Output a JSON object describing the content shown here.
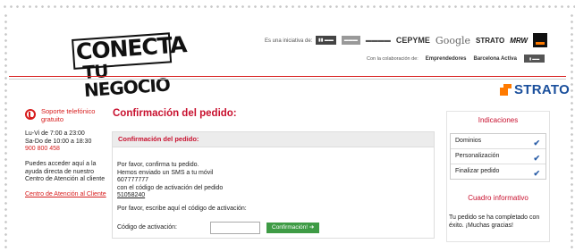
{
  "header": {
    "logo_line1": "CONECTA",
    "logo_line2": "TU NEGOCIO",
    "initiative_label": "Es una iniciativa de:",
    "sponsors": [
      "CEPYME",
      "Google",
      "STRATO",
      "MRW"
    ],
    "collab_label": "Con la colaboración de:",
    "collab_partners": [
      "Emprendedores",
      "Barcelona Activa"
    ]
  },
  "strato_logo": "STRATO",
  "sidebar": {
    "support_title": "Soporte telefónico gratuito",
    "hours_weekday": "Lu-Vi de 7:00 a 23:00",
    "hours_weekend": "Sa-Do de 10:00 a 18:30",
    "phone": "900 800 458",
    "help_text": "Puedes acceder aquí a la ayuda directa de nuestro Centro de Atención al cliente",
    "help_link": "Centro de Atención al Cliente"
  },
  "main": {
    "title": "Confirmación del pedido:",
    "panel_title": "Confirmación del pedido:",
    "line1": "Por favor, confirma tu pedido.",
    "line2": "Hemos enviado un SMS a tu móvil",
    "mobile": "607777777",
    "line3": "con el código de activación del pedido",
    "order_code": "51058240",
    "prompt": "Por favor, escribe aquí el código de activación:",
    "code_label": "Código de activación:",
    "code_value": "",
    "confirm_button": "Confirmación! ➔"
  },
  "right": {
    "indicaciones_title": "Indicaciones",
    "steps": [
      {
        "label": "Dominios",
        "done": true
      },
      {
        "label": "Personalización",
        "done": true
      },
      {
        "label": "Finalizar pedido",
        "done": true
      }
    ],
    "info_title": "Cuadro informativo",
    "info_text": "Tu pedido se ha completado con éxito. ¡Muchas gracias!"
  },
  "colors": {
    "brand_red": "#c8102e",
    "strato_blue": "#1a4f9c",
    "strato_orange": "#ff7a00",
    "button_green": "#3e9b45",
    "check_blue": "#2c5fa8"
  }
}
